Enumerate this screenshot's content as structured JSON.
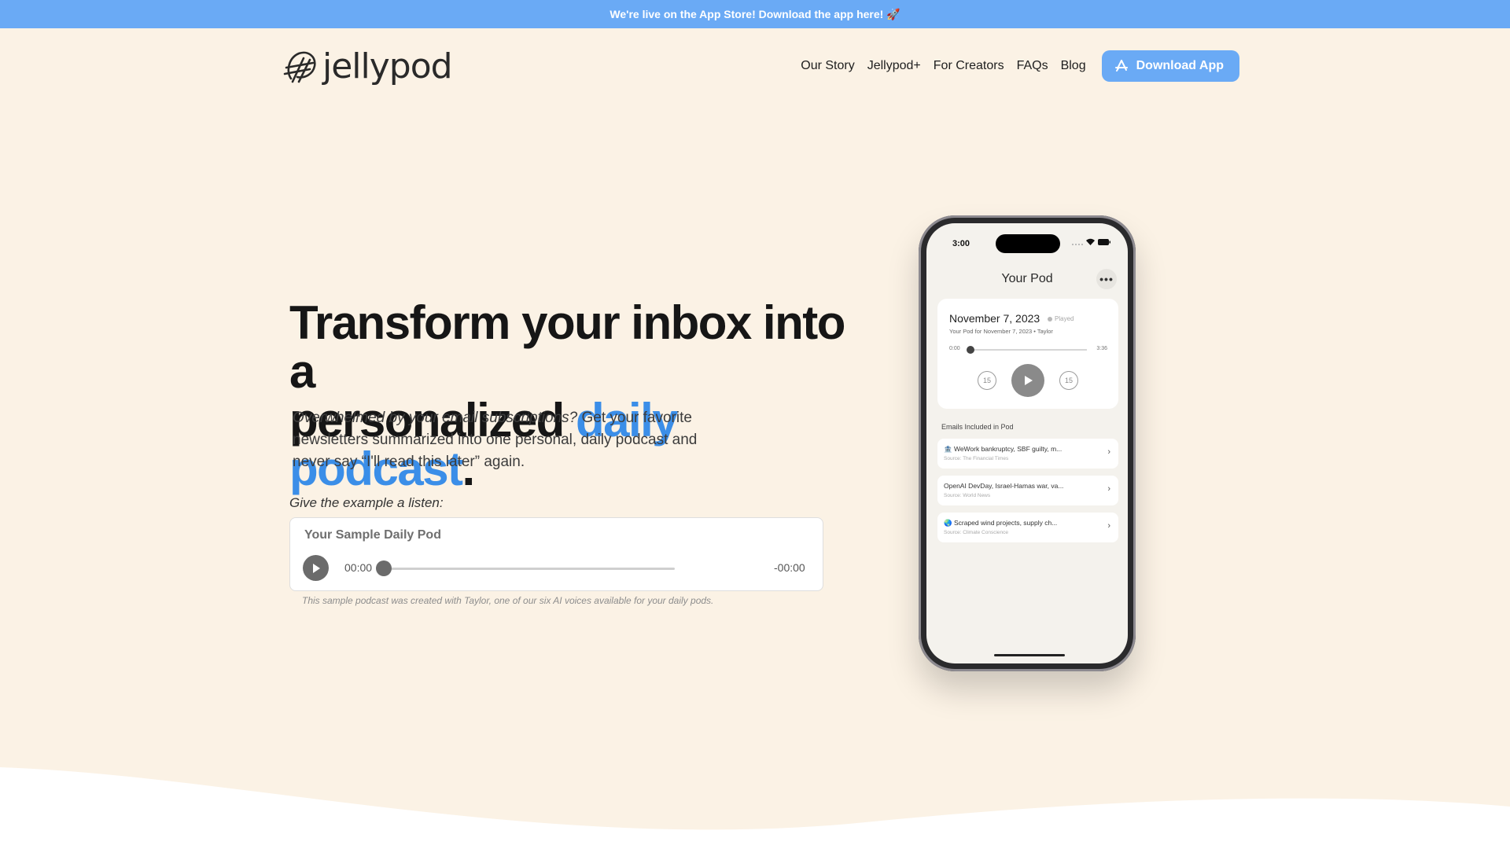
{
  "banner": {
    "text": "We're live on the App Store! Download the app here! 🚀"
  },
  "brand": {
    "name": "jellypod"
  },
  "nav": {
    "items": [
      "Our Story",
      "Jellypod+",
      "For Creators",
      "FAQs",
      "Blog"
    ],
    "cta": "Download App"
  },
  "hero": {
    "headline_line1": "Transform your inbox into a",
    "headline_line2_plain": "personalized ",
    "headline_line2_accent": "daily podcast",
    "headline_line2_end": ".",
    "subtext_italic": "Overwhelmed by your email subscriptions?",
    "subtext_rest": " Get your favorite newsletters summarized into one personal, daily podcast and never say “I'll read this later” again.",
    "listen_label": "Give the example a listen:"
  },
  "player": {
    "title": "Your Sample Daily Pod",
    "current_time": "00:00",
    "remaining_time": "-00:00",
    "caption": "This sample podcast was created with Taylor, one of our six AI voices available for your daily pods."
  },
  "phone": {
    "status_time": "3:00",
    "title": "Your Pod",
    "more": "•••",
    "card": {
      "date": "November 7, 2023",
      "played": "Played",
      "subtitle": "Your Pod for November 7, 2023 • Taylor",
      "start_time": "0:00",
      "end_time": "3:36",
      "skip_back": "15",
      "skip_forward": "15"
    },
    "emails_label": "Emails Included in Pod",
    "emails": [
      {
        "title": "🏦 WeWork bankruptcy, SBF guilty, m...",
        "source": "Source: The Financial Times"
      },
      {
        "title": "OpenAI DevDay, Israel-Hamas war, va...",
        "source": "Source: World News"
      },
      {
        "title": "🌏 Scraped wind projects, supply ch...",
        "source": "Source: Climate Conscience"
      }
    ]
  },
  "colors": {
    "accent": "#3b8ee8",
    "banner": "#6aaaf5",
    "hero_bg": "#fbf2e5"
  }
}
